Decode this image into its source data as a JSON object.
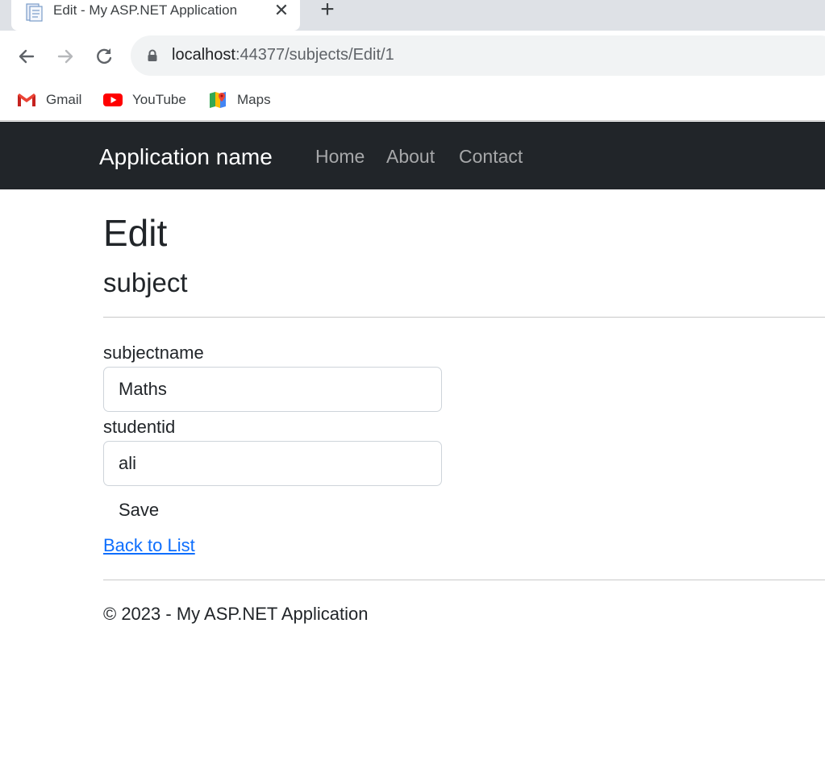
{
  "browser": {
    "tab_title": "Edit - My ASP.NET Application",
    "url_host": "localhost",
    "url_rest": ":44377/subjects/Edit/1",
    "bookmarks": [
      {
        "label": "Gmail",
        "icon": "gmail-icon"
      },
      {
        "label": "YouTube",
        "icon": "youtube-icon"
      },
      {
        "label": "Maps",
        "icon": "maps-icon"
      }
    ]
  },
  "navbar": {
    "brand": "Application name",
    "links": [
      "Home",
      "About",
      "Contact"
    ]
  },
  "page": {
    "title": "Edit",
    "subtitle": "subject",
    "fields": [
      {
        "label": "subjectname",
        "value": "Maths"
      },
      {
        "label": "studentid",
        "value": "ali"
      }
    ],
    "save_label": "Save",
    "back_label": "Back to List",
    "footer": "© 2023 - My ASP.NET Application"
  },
  "colors": {
    "navbar_bg": "#212529",
    "link": "#0d6efd"
  }
}
